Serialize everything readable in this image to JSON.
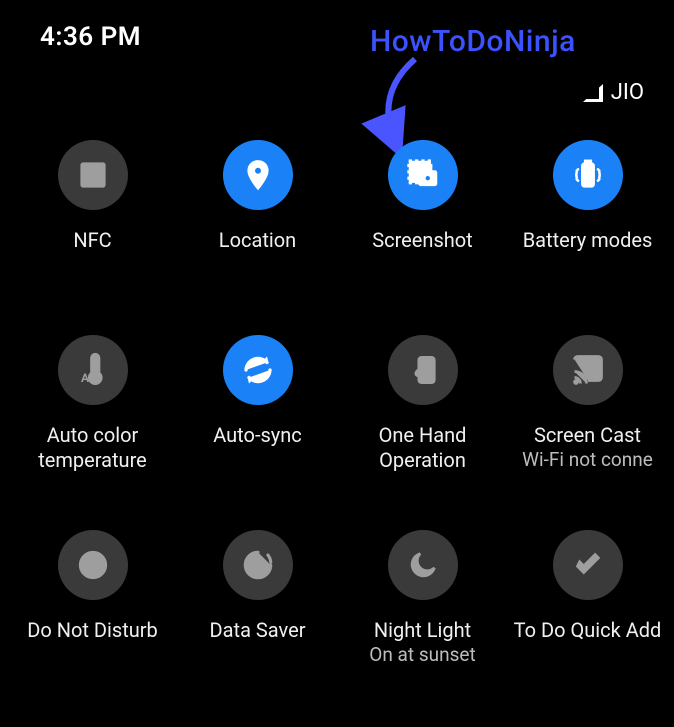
{
  "status": {
    "time": "4:36 PM",
    "carrier": "JIO"
  },
  "overlay": {
    "watermark": "HowToDoNinja"
  },
  "tiles": {
    "nfc": {
      "label": "NFC"
    },
    "location": {
      "label": "Location"
    },
    "screenshot": {
      "label": "Screenshot"
    },
    "battery": {
      "label": "Battery modes"
    },
    "autocolor": {
      "label": "Auto color temperature"
    },
    "autosync": {
      "label": "Auto-sync"
    },
    "onehand": {
      "label": "One Hand Operation"
    },
    "cast": {
      "label": "Screen Cast",
      "sub": "Wi-Fi not conne"
    },
    "dnd": {
      "label": "Do Not Disturb"
    },
    "datasaver": {
      "label": "Data Saver"
    },
    "nightlight": {
      "label": "Night Light",
      "sub": "On at sunset"
    },
    "todo": {
      "label": "To Do Quick Add"
    }
  }
}
